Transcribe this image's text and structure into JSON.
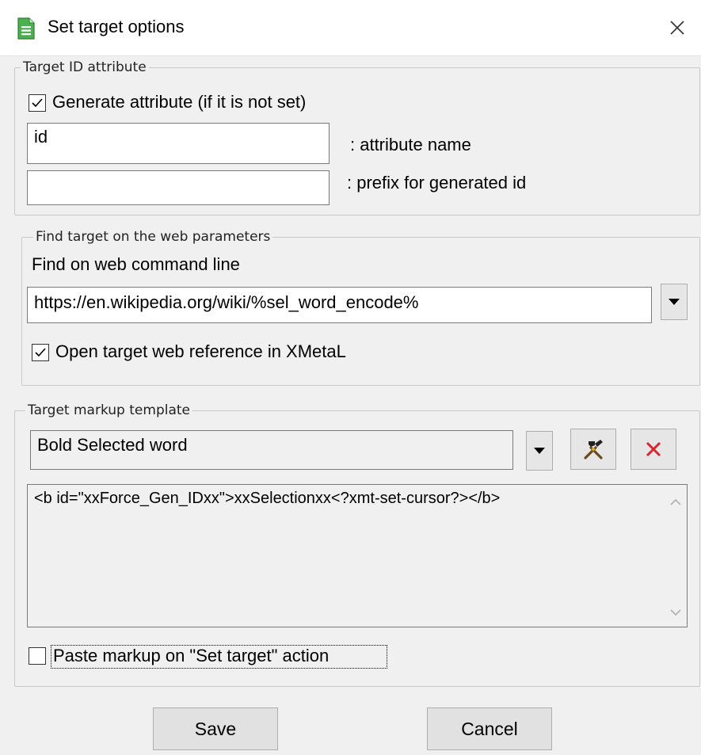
{
  "window": {
    "title": "Set target options",
    "title_icon": "document-icon",
    "close_icon": "close-icon"
  },
  "target_id": {
    "legend": "Target ID attribute",
    "generate_label": "Generate attribute (if it is not set)",
    "generate_checked": true,
    "attribute_name_value": "id",
    "attribute_name_label": ": attribute name",
    "prefix_value": "",
    "prefix_label": ": prefix for generated id"
  },
  "web": {
    "legend": "Find target on the web parameters",
    "command_line_label": "Find on web command line",
    "command_line_value": "https://en.wikipedia.org/wiki/%sel_word_encode%",
    "open_in_xmetal_label": "Open target web reference in XMetaL",
    "open_in_xmetal_checked": true
  },
  "markup": {
    "legend": "Target markup template",
    "template_value": "Bold Selected word",
    "edit_icon": "tools-icon",
    "delete_icon": "delete-x-icon",
    "template_text": "<b id=\"xxForce_Gen_IDxx\">xxSelectionxx<?xmt-set-cursor?></b>",
    "paste_label": "Paste markup on \"Set target\" action",
    "paste_checked": false
  },
  "buttons": {
    "save": "Save",
    "cancel": "Cancel"
  },
  "colors": {
    "accent_red": "#d9262c",
    "icon_green": "#3c9a3c"
  }
}
